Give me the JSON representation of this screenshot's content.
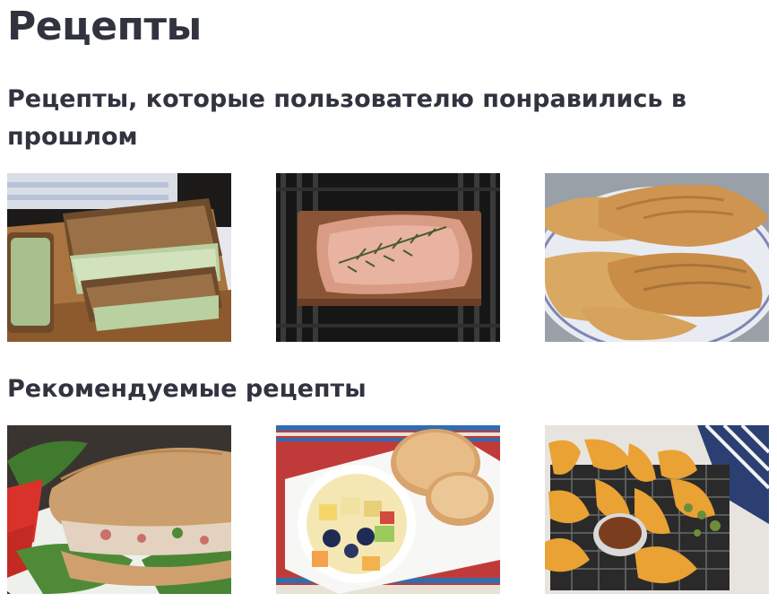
{
  "page": {
    "title": "Рецепты"
  },
  "sections": [
    {
      "heading": "Рецепты, которые пользователю понравились в прошлом",
      "recipes": [
        {
          "alt": "sandwich-photo"
        },
        {
          "alt": "salmon-plank-photo"
        },
        {
          "alt": "croissants-photo"
        }
      ]
    },
    {
      "heading": "Рекомендуемые рецепты",
      "recipes": [
        {
          "alt": "sub-sandwich-photo"
        },
        {
          "alt": "fruit-salad-muffins-photo"
        },
        {
          "alt": "baked-chicken-strips-photo"
        }
      ]
    }
  ]
}
